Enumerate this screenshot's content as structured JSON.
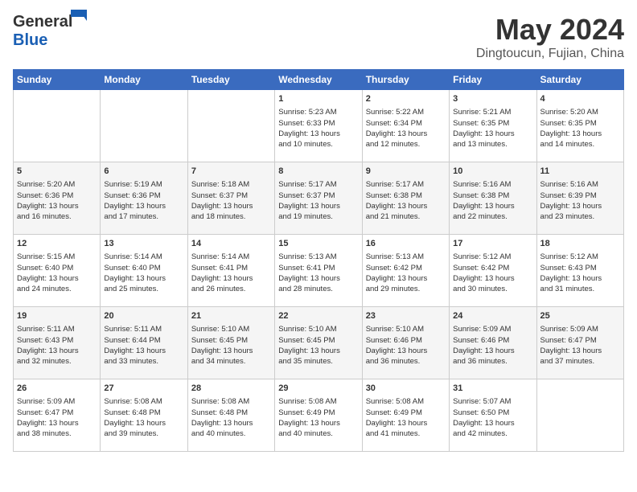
{
  "header": {
    "logo_general": "General",
    "logo_blue": "Blue",
    "month_title": "May 2024",
    "location": "Dingtoucun, Fujian, China"
  },
  "weekdays": [
    "Sunday",
    "Monday",
    "Tuesday",
    "Wednesday",
    "Thursday",
    "Friday",
    "Saturday"
  ],
  "weeks": [
    [
      {
        "day": "",
        "content": ""
      },
      {
        "day": "",
        "content": ""
      },
      {
        "day": "",
        "content": ""
      },
      {
        "day": "1",
        "content": "Sunrise: 5:23 AM\nSunset: 6:33 PM\nDaylight: 13 hours\nand 10 minutes."
      },
      {
        "day": "2",
        "content": "Sunrise: 5:22 AM\nSunset: 6:34 PM\nDaylight: 13 hours\nand 12 minutes."
      },
      {
        "day": "3",
        "content": "Sunrise: 5:21 AM\nSunset: 6:35 PM\nDaylight: 13 hours\nand 13 minutes."
      },
      {
        "day": "4",
        "content": "Sunrise: 5:20 AM\nSunset: 6:35 PM\nDaylight: 13 hours\nand 14 minutes."
      }
    ],
    [
      {
        "day": "5",
        "content": "Sunrise: 5:20 AM\nSunset: 6:36 PM\nDaylight: 13 hours\nand 16 minutes."
      },
      {
        "day": "6",
        "content": "Sunrise: 5:19 AM\nSunset: 6:36 PM\nDaylight: 13 hours\nand 17 minutes."
      },
      {
        "day": "7",
        "content": "Sunrise: 5:18 AM\nSunset: 6:37 PM\nDaylight: 13 hours\nand 18 minutes."
      },
      {
        "day": "8",
        "content": "Sunrise: 5:17 AM\nSunset: 6:37 PM\nDaylight: 13 hours\nand 19 minutes."
      },
      {
        "day": "9",
        "content": "Sunrise: 5:17 AM\nSunset: 6:38 PM\nDaylight: 13 hours\nand 21 minutes."
      },
      {
        "day": "10",
        "content": "Sunrise: 5:16 AM\nSunset: 6:38 PM\nDaylight: 13 hours\nand 22 minutes."
      },
      {
        "day": "11",
        "content": "Sunrise: 5:16 AM\nSunset: 6:39 PM\nDaylight: 13 hours\nand 23 minutes."
      }
    ],
    [
      {
        "day": "12",
        "content": "Sunrise: 5:15 AM\nSunset: 6:40 PM\nDaylight: 13 hours\nand 24 minutes."
      },
      {
        "day": "13",
        "content": "Sunrise: 5:14 AM\nSunset: 6:40 PM\nDaylight: 13 hours\nand 25 minutes."
      },
      {
        "day": "14",
        "content": "Sunrise: 5:14 AM\nSunset: 6:41 PM\nDaylight: 13 hours\nand 26 minutes."
      },
      {
        "day": "15",
        "content": "Sunrise: 5:13 AM\nSunset: 6:41 PM\nDaylight: 13 hours\nand 28 minutes."
      },
      {
        "day": "16",
        "content": "Sunrise: 5:13 AM\nSunset: 6:42 PM\nDaylight: 13 hours\nand 29 minutes."
      },
      {
        "day": "17",
        "content": "Sunrise: 5:12 AM\nSunset: 6:42 PM\nDaylight: 13 hours\nand 30 minutes."
      },
      {
        "day": "18",
        "content": "Sunrise: 5:12 AM\nSunset: 6:43 PM\nDaylight: 13 hours\nand 31 minutes."
      }
    ],
    [
      {
        "day": "19",
        "content": "Sunrise: 5:11 AM\nSunset: 6:43 PM\nDaylight: 13 hours\nand 32 minutes."
      },
      {
        "day": "20",
        "content": "Sunrise: 5:11 AM\nSunset: 6:44 PM\nDaylight: 13 hours\nand 33 minutes."
      },
      {
        "day": "21",
        "content": "Sunrise: 5:10 AM\nSunset: 6:45 PM\nDaylight: 13 hours\nand 34 minutes."
      },
      {
        "day": "22",
        "content": "Sunrise: 5:10 AM\nSunset: 6:45 PM\nDaylight: 13 hours\nand 35 minutes."
      },
      {
        "day": "23",
        "content": "Sunrise: 5:10 AM\nSunset: 6:46 PM\nDaylight: 13 hours\nand 36 minutes."
      },
      {
        "day": "24",
        "content": "Sunrise: 5:09 AM\nSunset: 6:46 PM\nDaylight: 13 hours\nand 36 minutes."
      },
      {
        "day": "25",
        "content": "Sunrise: 5:09 AM\nSunset: 6:47 PM\nDaylight: 13 hours\nand 37 minutes."
      }
    ],
    [
      {
        "day": "26",
        "content": "Sunrise: 5:09 AM\nSunset: 6:47 PM\nDaylight: 13 hours\nand 38 minutes."
      },
      {
        "day": "27",
        "content": "Sunrise: 5:08 AM\nSunset: 6:48 PM\nDaylight: 13 hours\nand 39 minutes."
      },
      {
        "day": "28",
        "content": "Sunrise: 5:08 AM\nSunset: 6:48 PM\nDaylight: 13 hours\nand 40 minutes."
      },
      {
        "day": "29",
        "content": "Sunrise: 5:08 AM\nSunset: 6:49 PM\nDaylight: 13 hours\nand 40 minutes."
      },
      {
        "day": "30",
        "content": "Sunrise: 5:08 AM\nSunset: 6:49 PM\nDaylight: 13 hours\nand 41 minutes."
      },
      {
        "day": "31",
        "content": "Sunrise: 5:07 AM\nSunset: 6:50 PM\nDaylight: 13 hours\nand 42 minutes."
      },
      {
        "day": "",
        "content": ""
      }
    ]
  ]
}
